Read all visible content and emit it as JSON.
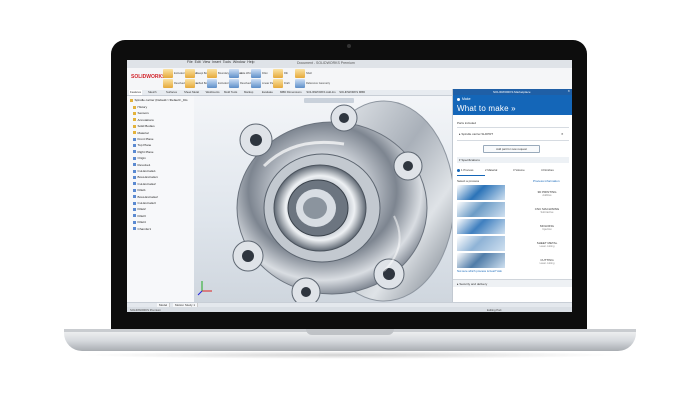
{
  "app": {
    "logo_text": "SOLIDWORKS",
    "brand_color": "#d2232a",
    "title": "Document - SOLIDWORKS Premium",
    "menu": [
      "File",
      "Edit",
      "View",
      "Insert",
      "Tools",
      "Window",
      "Help"
    ]
  },
  "ribbon": {
    "groups": [
      {
        "label": "Extruded Boss/Base",
        "color": "orange"
      },
      {
        "label": "Revolved Boss/Base",
        "color": "orange"
      },
      {
        "label": "Swept Boss/Base",
        "color": "orange"
      },
      {
        "label": "Lofted Boss/Base",
        "color": "orange"
      },
      {
        "label": "Boundary Boss/Base",
        "color": "orange"
      },
      {
        "label": "Extruded Cut",
        "color": "blue"
      },
      {
        "label": "Hole Wizard",
        "color": "blue"
      },
      {
        "label": "Revolved Cut",
        "color": "blue"
      },
      {
        "label": "Fillet",
        "color": "blue"
      },
      {
        "label": "Linear Pattern",
        "color": "blue"
      },
      {
        "label": "Rib",
        "color": "orange"
      },
      {
        "label": "Draft",
        "color": "orange"
      },
      {
        "label": "Shell",
        "color": "orange"
      },
      {
        "label": "Reference Geometry",
        "color": "blue"
      }
    ]
  },
  "command_tabs": [
    "Features",
    "Sketch",
    "Surfaces",
    "Sheet Metal",
    "Weldments",
    "Mold Tools",
    "Markup",
    "Evaluate",
    "MBD Dimensions",
    "SOLIDWORKS Add-Ins",
    "SOLIDWORKS MBD"
  ],
  "feature_tree": {
    "root": "Spindle carrier (Default<<Default>_Dis",
    "items": [
      "History",
      "Sensors",
      "Annotations",
      "Solid Bodies",
      "Material",
      "Front Plane",
      "Top Plane",
      "Right Plane",
      "Origin",
      "Revolve1",
      "Cut-Extrude1",
      "Boss-Extrude1",
      "Cut-Extrude2",
      "Fillet1",
      "Boss-Extrude2",
      "Cut-Extrude3",
      "Fillet2",
      "Fillet3",
      "Fillet4",
      "Chamfer1"
    ]
  },
  "bottom_tabs": [
    "Model",
    "Motion Study 1"
  ],
  "status": {
    "left": "SOLIDWORKS Premium",
    "right": "Editing Part"
  },
  "panel": {
    "header_small": "SOLIDWORKS Marketplace",
    "app_name": "Make",
    "title": "What to make »",
    "parts_label": "Parts included",
    "part_item": "Spindle carrier.SLDPRT",
    "add_button": "Add part for new request",
    "spec_label": "Specifications",
    "steps": [
      "1 Process",
      "2 Material",
      "3 Volume",
      "4 Finishes"
    ],
    "process_label": "Select a process",
    "process_info": "Process information",
    "processes": [
      {
        "name": "3D PRINTING",
        "desc": "Additive",
        "thumb_color": "#2b73b8"
      },
      {
        "name": "CNC MACHINING",
        "desc": "Subtractive",
        "thumb_color": "#6c9cc6"
      },
      {
        "name": "MOLDING",
        "desc": "Injection",
        "thumb_color": "#3f7fbf"
      },
      {
        "name": "SHEET METAL",
        "desc": "Laser cutting",
        "thumb_color": "#8fb3d6"
      },
      {
        "name": "CUTTING",
        "desc": "Laser cutting",
        "thumb_color": "#507ca8"
      }
    ],
    "link": "Not sure which process is best? Ask",
    "footer": "Security and delivery"
  }
}
